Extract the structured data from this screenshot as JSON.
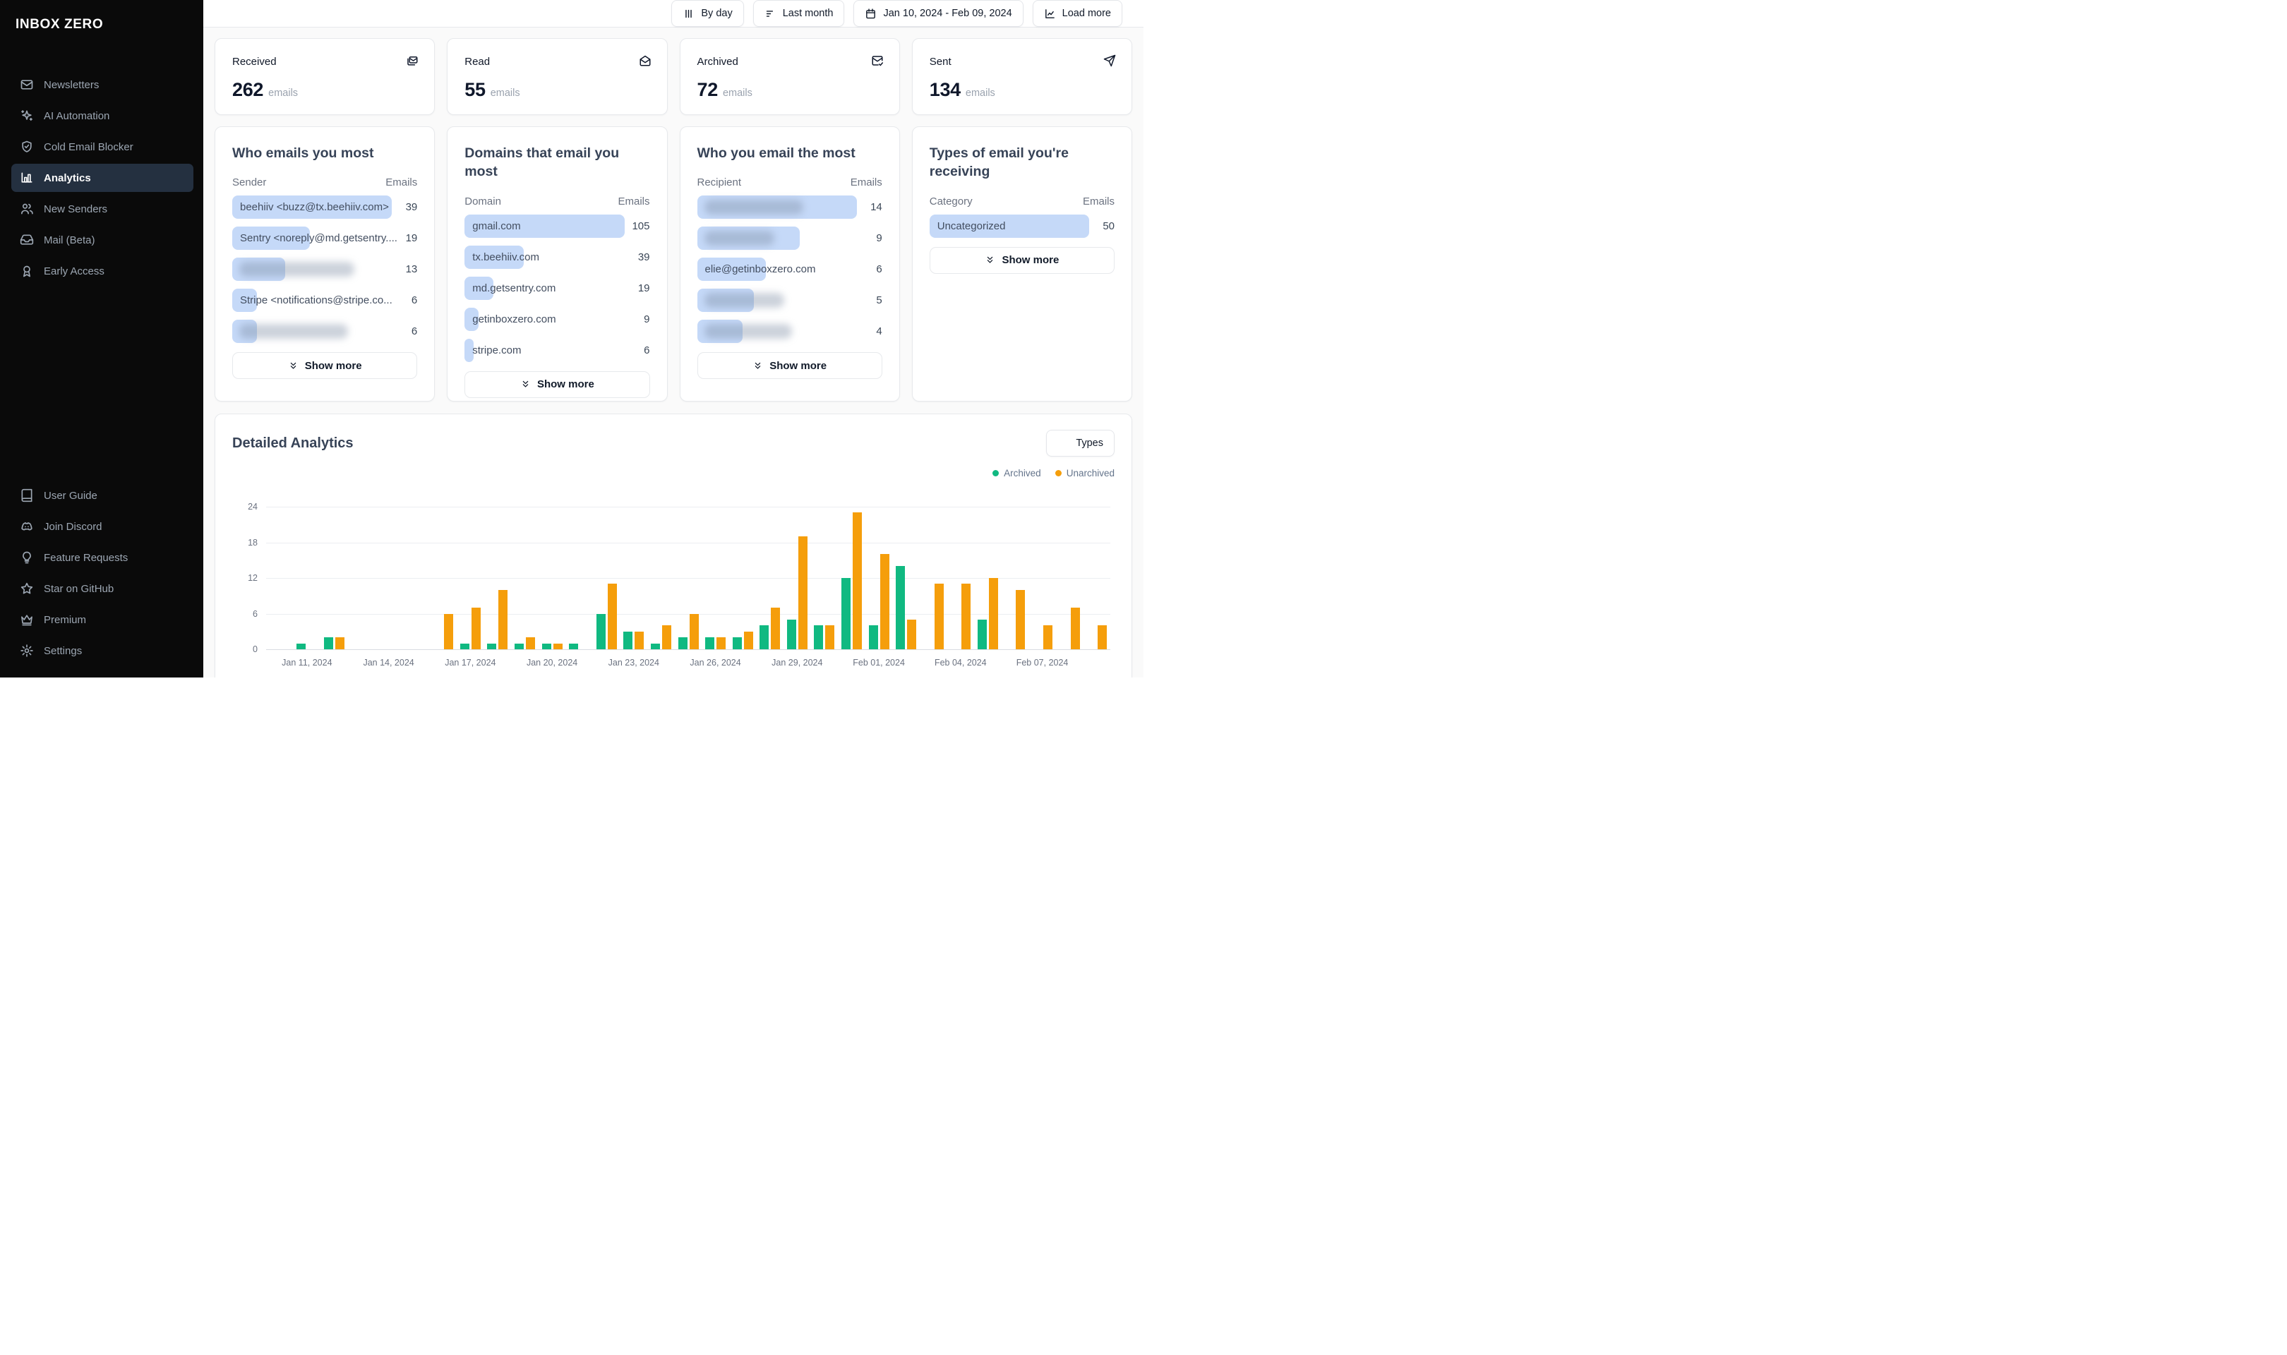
{
  "sidebar": {
    "logo": "INBOX ZERO",
    "nav": [
      {
        "label": "Newsletters",
        "icon": "mail-icon",
        "active": false
      },
      {
        "label": "AI Automation",
        "icon": "sparkles-icon",
        "active": false
      },
      {
        "label": "Cold Email Blocker",
        "icon": "shield-check-icon",
        "active": false
      },
      {
        "label": "Analytics",
        "icon": "bar-chart-icon",
        "active": true
      },
      {
        "label": "New Senders",
        "icon": "users-icon",
        "active": false
      },
      {
        "label": "Mail (Beta)",
        "icon": "inbox-icon",
        "active": false
      },
      {
        "label": "Early Access",
        "icon": "ribbon-icon",
        "active": false
      }
    ],
    "footer": [
      {
        "label": "User Guide",
        "icon": "book-icon"
      },
      {
        "label": "Join Discord",
        "icon": "discord-icon"
      },
      {
        "label": "Feature Requests",
        "icon": "lightbulb-icon"
      },
      {
        "label": "Star on GitHub",
        "icon": "star-icon"
      },
      {
        "label": "Premium",
        "icon": "crown-icon"
      },
      {
        "label": "Settings",
        "icon": "gear-icon"
      }
    ]
  },
  "toolbar": {
    "buttons": [
      {
        "label": "By day",
        "icon": "columns-icon"
      },
      {
        "label": "Last month",
        "icon": "sliders-icon"
      },
      {
        "label": "Jan 10, 2024 - Feb 09, 2024",
        "icon": "calendar-icon"
      },
      {
        "label": "Load more",
        "icon": "chart-line-icon"
      }
    ]
  },
  "stats": {
    "unit": "emails",
    "cards": [
      {
        "label": "Received",
        "value": "262",
        "icon": "mails-icon"
      },
      {
        "label": "Read",
        "value": "55",
        "icon": "mail-open-icon"
      },
      {
        "label": "Archived",
        "value": "72",
        "icon": "mail-check-icon"
      },
      {
        "label": "Sent",
        "value": "134",
        "icon": "send-icon"
      }
    ]
  },
  "lists": {
    "show_more_label": "Show more",
    "cards": [
      {
        "title": "Who emails you most",
        "col1": "Sender",
        "col2": "Emails",
        "rows": [
          {
            "text": "beehiiv <buzz@tx.beehiiv.com>",
            "value": 39,
            "bar_pct": 100,
            "redacted": false
          },
          {
            "text": "Sentry <noreply@md.getsentry....",
            "value": 19,
            "bar_pct": 48.7,
            "redacted": false
          },
          {
            "text": null,
            "value": 13,
            "bar_pct": 33.3,
            "redacted": true,
            "blob_pct": 72
          },
          {
            "text": "Stripe <notifications@stripe.co...",
            "value": 6,
            "bar_pct": 15.4,
            "redacted": false
          },
          {
            "text": null,
            "value": 6,
            "bar_pct": 15.4,
            "redacted": true,
            "blob_pct": 68
          }
        ]
      },
      {
        "title": "Domains that email you most",
        "col1": "Domain",
        "col2": "Emails",
        "rows": [
          {
            "text": "gmail.com",
            "value": 105,
            "bar_pct": 100,
            "redacted": false
          },
          {
            "text": "tx.beehiiv.com",
            "value": 39,
            "bar_pct": 37.1,
            "redacted": false
          },
          {
            "text": "md.getsentry.com",
            "value": 19,
            "bar_pct": 18.1,
            "redacted": false
          },
          {
            "text": "getinboxzero.com",
            "value": 9,
            "bar_pct": 8.6,
            "redacted": false
          },
          {
            "text": "stripe.com",
            "value": 6,
            "bar_pct": 5.7,
            "redacted": false
          }
        ]
      },
      {
        "title": "Who you email the most",
        "col1": "Recipient",
        "col2": "Emails",
        "rows": [
          {
            "text": null,
            "value": 14,
            "bar_pct": 100,
            "redacted": true,
            "blob_pct": 62
          },
          {
            "text": null,
            "value": 9,
            "bar_pct": 64.3,
            "redacted": true,
            "blob_pct": 44
          },
          {
            "text": "elie@getinboxzero.com",
            "value": 6,
            "bar_pct": 42.9,
            "redacted": false
          },
          {
            "text": null,
            "value": 5,
            "bar_pct": 35.7,
            "redacted": true,
            "blob_pct": 50
          },
          {
            "text": null,
            "value": 4,
            "bar_pct": 28.6,
            "redacted": true,
            "blob_pct": 55
          }
        ]
      },
      {
        "title": "Types of email you're receiving",
        "col1": "Category",
        "col2": "Emails",
        "rows": [
          {
            "text": "Uncategorized",
            "value": 50,
            "bar_pct": 100,
            "redacted": false
          }
        ]
      }
    ]
  },
  "detailed": {
    "title": "Detailed Analytics",
    "filter_button": "Types",
    "legend": [
      {
        "label": "Archived",
        "color": "#10b981"
      },
      {
        "label": "Unarchived",
        "color": "#f59e0b"
      }
    ]
  },
  "chart_data": {
    "type": "bar",
    "title": "Detailed Analytics",
    "x": [
      "Jan 10, 2024",
      "Jan 11, 2024",
      "Jan 12, 2024",
      "Jan 13, 2024",
      "Jan 14, 2024",
      "Jan 15, 2024",
      "Jan 16, 2024",
      "Jan 17, 2024",
      "Jan 18, 2024",
      "Jan 19, 2024",
      "Jan 20, 2024",
      "Jan 21, 2024",
      "Jan 22, 2024",
      "Jan 23, 2024",
      "Jan 24, 2024",
      "Jan 25, 2024",
      "Jan 26, 2024",
      "Jan 27, 2024",
      "Jan 28, 2024",
      "Jan 29, 2024",
      "Jan 30, 2024",
      "Jan 31, 2024",
      "Feb 01, 2024",
      "Feb 02, 2024",
      "Feb 03, 2024",
      "Feb 04, 2024",
      "Feb 05, 2024",
      "Feb 06, 2024",
      "Feb 07, 2024",
      "Feb 08, 2024",
      "Feb 09, 2024"
    ],
    "series": [
      {
        "name": "Archived",
        "color": "#10b981",
        "values": [
          0,
          1,
          2,
          0,
          0,
          0,
          0,
          1,
          1,
          1,
          1,
          1,
          6,
          3,
          1,
          2,
          2,
          2,
          4,
          5,
          4,
          12,
          4,
          14,
          0,
          0,
          5,
          0,
          0,
          0,
          0
        ]
      },
      {
        "name": "Unarchived",
        "color": "#f59e0b",
        "values": [
          0,
          0,
          2,
          0,
          0,
          0,
          6,
          7,
          10,
          2,
          1,
          0,
          11,
          3,
          4,
          6,
          2,
          3,
          7,
          19,
          4,
          23,
          16,
          5,
          11,
          11,
          12,
          10,
          4,
          7,
          4
        ]
      }
    ],
    "ylim": [
      0,
      24
    ],
    "yticks": [
      0,
      6,
      12,
      18,
      24
    ],
    "xtick_indices": [
      1,
      4,
      7,
      10,
      13,
      16,
      19,
      22,
      25,
      28
    ],
    "grid": "horizontal",
    "legend_position": "top-right"
  }
}
